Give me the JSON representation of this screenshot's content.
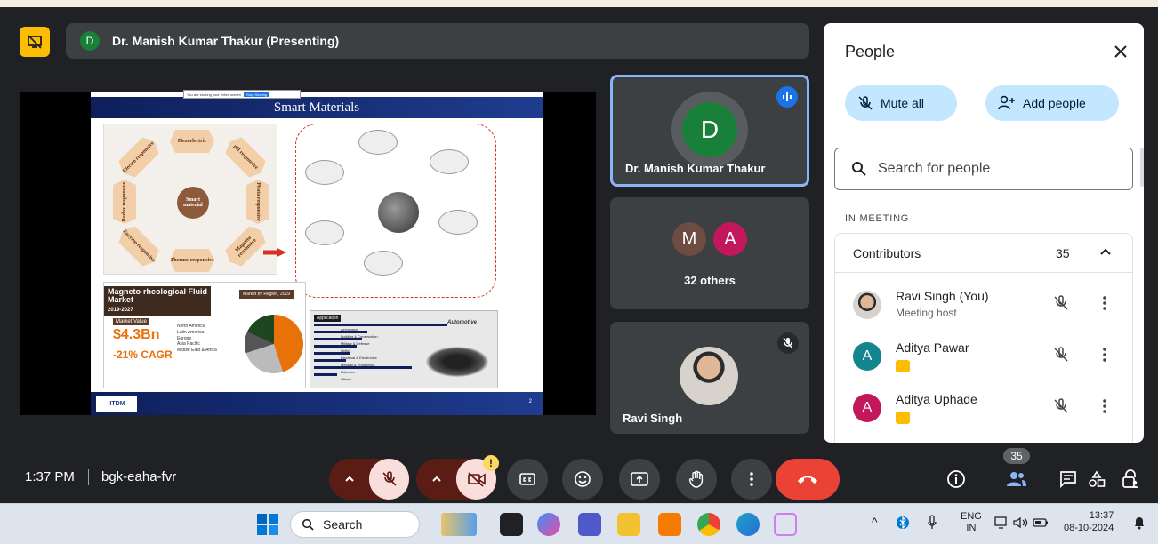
{
  "meeting": {
    "presenter_initial": "D",
    "presenter_label": "Dr. Manish Kumar Thakur (Presenting)",
    "time": "1:37 PM",
    "separator": "|",
    "code": "bgk-eaha-fvr"
  },
  "slide": {
    "share_notice": "You are sharing your entire screen",
    "stop_sharing": "Stop Sharing",
    "title": "Smart Materials",
    "hub_label": "Smart material",
    "petals": [
      "Piezoelectric",
      "Electro responsive",
      "pH responsive",
      "Redox responsive",
      "Photo responsive",
      "Enzyme responsive",
      "Thermo-responsive",
      "Magneto responsive"
    ],
    "mr_title": "Magneto-rheological Fluid Market",
    "mr_years": "2019-2027",
    "mr_region_label": "Market by Region, 2019",
    "mr_market_value_label": "Market Value",
    "mr_value": "$4.3Bn",
    "mr_cagr": "-21% CAGR",
    "mr_regions": [
      "North America",
      "Latin America",
      "Europe",
      "Asia Pacific",
      "Middle East & Africa"
    ],
    "application_label": "Application",
    "applications": [
      "Aerospace",
      "Building & Construction",
      "Military & Defense",
      "Optics",
      "Electrical & Electronics",
      "Medical & Prosthetics",
      "Robotics",
      "Others"
    ],
    "automotive_label": "Automotive",
    "logo": "IITDM",
    "page_number": "2"
  },
  "tiles": {
    "main_initial": "D",
    "main_name": "Dr. Manish Kumar Thakur",
    "group_initials": [
      "M",
      "A"
    ],
    "group_label": "32 others",
    "self_name": "Ravi Singh"
  },
  "people": {
    "title": "People",
    "mute_all": "Mute all",
    "add_people": "Add people",
    "search_placeholder": "Search for people",
    "in_meeting_label": "IN MEETING",
    "group_label": "Contributors",
    "group_count": "35",
    "participants": [
      {
        "name": "Ravi Singh (You)",
        "sub": "Meeting host",
        "initial": "",
        "color": "#c5a27a"
      },
      {
        "name": "Aditya Pawar",
        "sub": "",
        "initial": "A",
        "color": "#12858e"
      },
      {
        "name": "Aditya Uphade",
        "sub": "",
        "initial": "A",
        "color": "#c2185b"
      }
    ]
  },
  "controls": {
    "warning": "!",
    "people_count": "35"
  },
  "taskbar": {
    "search": "Search",
    "lang_top": "ENG",
    "lang_bottom": "IN",
    "clock_time": "13:37",
    "clock_date": "08-10-2024"
  },
  "colors": {
    "meet_bg": "#202124",
    "tile_bg": "#3c4043",
    "active_border": "#8ab4f8",
    "accent_pill": "#c2e7ff",
    "end_call": "#ea4335",
    "presenter_green": "#188038"
  }
}
